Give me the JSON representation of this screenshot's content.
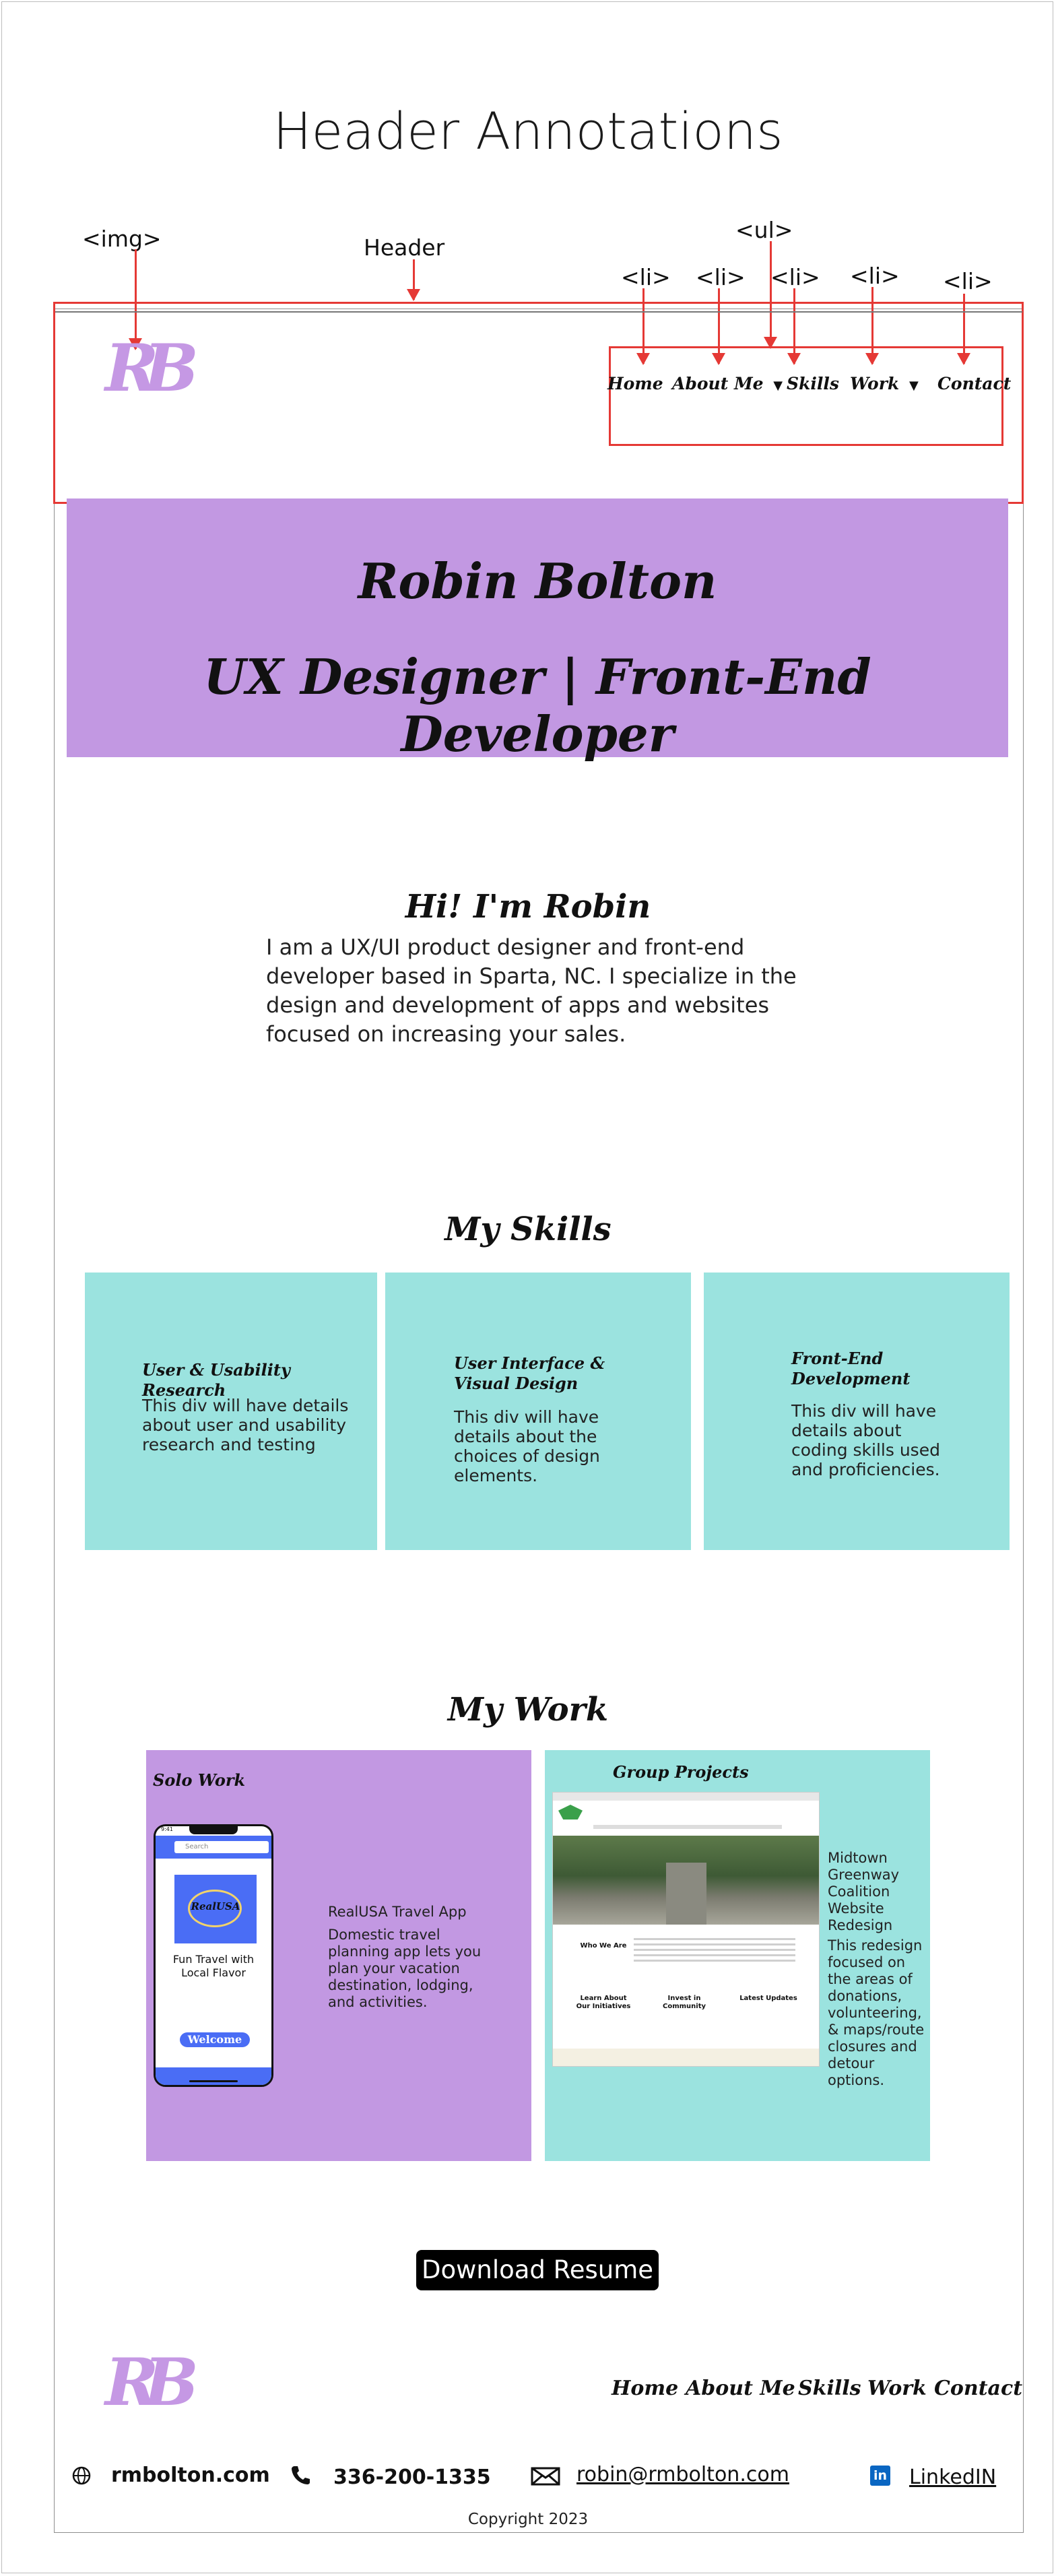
{
  "title": "Header Annotations",
  "annotations": {
    "img": "<img>",
    "header": "Header",
    "ul": "<ul>",
    "li": "<li>"
  },
  "logo": "RB",
  "nav": [
    "Home",
    "About Me",
    "Skills",
    "Work",
    "Contact"
  ],
  "dropdown_caret": "▼",
  "hero": {
    "name": "Robin Bolton",
    "role": "UX Designer | Front-End Developer"
  },
  "intro": {
    "heading": "Hi! I'm Robin",
    "body": "I am a UX/UI product designer and front-end developer based in Sparta, NC. I specialize in the design and development of apps and websites focused on increasing your sales."
  },
  "skills": {
    "heading": "My Skills",
    "cards": [
      {
        "title": "User & Usability Research",
        "body": "This div will have details about user and usability research and testing"
      },
      {
        "title": "User Interface & Visual Design",
        "body": "This div will have details about the choices of design elements."
      },
      {
        "title": "Front-End Development",
        "body": "This div will have details about coding skills used and proficiencies."
      }
    ]
  },
  "work": {
    "heading": "My Work",
    "solo": {
      "label": "Solo Work",
      "app_title": "RealUSA Travel App",
      "app_desc": "Domestic travel planning app lets you plan your vacation destination, lodging, and activities.",
      "phone": {
        "time": "9:41",
        "search": "Search",
        "logo": "RealUSA",
        "tagline": "Fun Travel with Local Flavor",
        "button": "Welcome"
      }
    },
    "group": {
      "label": "Group Projects",
      "project_title": "Midtown Greenway Coalition Website Redesign",
      "project_desc": "This redesign focused on the areas of donations, volunteering, & maps/route closures and detour options.",
      "site": {
        "who": "Who We Are",
        "initiatives": "Learn About Our Initiatives",
        "community": "Invest in Community",
        "updates": "Latest Updates"
      }
    }
  },
  "resume_button": "Download Resume",
  "footer": {
    "website": "rmbolton.com",
    "phone": "336-200-1335",
    "email": "robin@rmbolton.com",
    "linkedin": "LinkedIN",
    "copyright": "Copyright 2023"
  },
  "colors": {
    "purple": "#c298e2",
    "teal": "#9be3df",
    "annotation_red": "#e53935"
  }
}
